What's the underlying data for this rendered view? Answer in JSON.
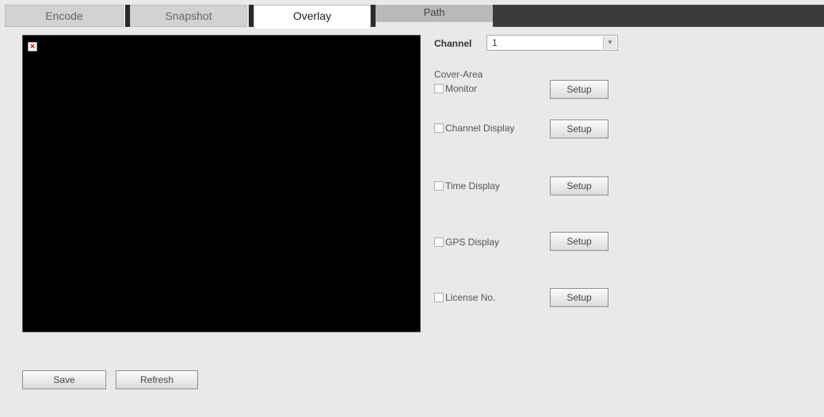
{
  "tabs": [
    {
      "label": "Encode"
    },
    {
      "label": "Snapshot"
    },
    {
      "label": "Overlay"
    },
    {
      "label": "Path"
    }
  ],
  "channel": {
    "label": "Channel",
    "value": "1"
  },
  "cover_area": {
    "label": "Cover-Area"
  },
  "options": [
    {
      "label": "Monitor",
      "button": "Setup"
    },
    {
      "label": "Channel Display",
      "button": "Setup"
    },
    {
      "label": "Time Display",
      "button": "Setup"
    },
    {
      "label": "GPS Display",
      "button": "Setup"
    },
    {
      "label": "License No.",
      "button": "Setup"
    }
  ],
  "actions": {
    "save": "Save",
    "refresh": "Refresh"
  },
  "broken_image_glyph": "×"
}
